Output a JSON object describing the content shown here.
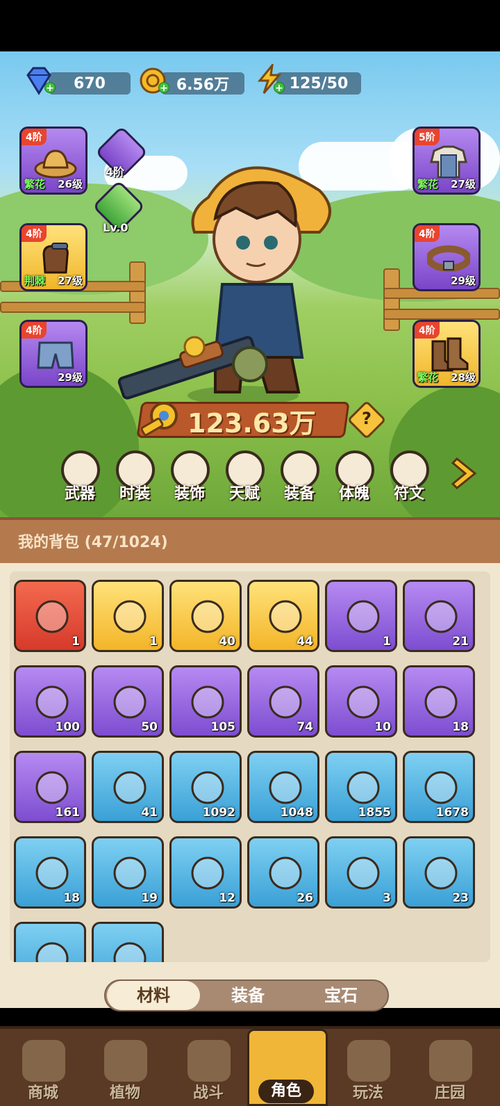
{
  "resources": {
    "gems": "670",
    "gold": "6.56万",
    "energy": "125/50"
  },
  "equipment_left": [
    {
      "tier": "4阶",
      "quality": "繁花",
      "level": "26级",
      "icon": "straw-hat-icon"
    },
    {
      "tier": "4阶",
      "quality": "荆棘",
      "level": "27级",
      "icon": "glove-icon"
    },
    {
      "tier": "4阶",
      "quality": "",
      "level": "29级",
      "icon": "shorts-icon"
    }
  ],
  "equipment_right": [
    {
      "tier": "5阶",
      "quality": "繁花",
      "level": "27级",
      "icon": "overalls-icon"
    },
    {
      "tier": "4阶",
      "quality": "",
      "level": "29级",
      "icon": "belt-icon"
    },
    {
      "tier": "4阶",
      "quality": "繁花",
      "level": "28级",
      "icon": "boots-icon"
    }
  ],
  "mini_slots": [
    {
      "label": "4阶",
      "icon": "bag-icon"
    },
    {
      "label": "Lv.0",
      "icon": "green-gem-icon"
    }
  ],
  "power": "123.63万",
  "categories": [
    "武器",
    "时装",
    "装饰",
    "天赋",
    "装备",
    "体魄",
    "符文"
  ],
  "bag": {
    "title": "我的背包 (47/1024)",
    "items": [
      {
        "count": "1",
        "rarity": "red",
        "icon": "red-potion-icon"
      },
      {
        "count": "1",
        "rarity": "gold",
        "icon": "gold-key-icon"
      },
      {
        "count": "40",
        "rarity": "gold",
        "icon": "orange-potion-icon"
      },
      {
        "count": "44",
        "rarity": "gold",
        "icon": "spell-book-icon"
      },
      {
        "count": "1",
        "rarity": "purple",
        "icon": "silver-key-icon"
      },
      {
        "count": "21",
        "rarity": "purple",
        "icon": "green-scroll-icon"
      },
      {
        "count": "100",
        "rarity": "purple",
        "icon": "scroll-icon"
      },
      {
        "count": "50",
        "rarity": "purple",
        "icon": "water-scroll-icon"
      },
      {
        "count": "105",
        "rarity": "purple",
        "icon": "fire-scroll-icon"
      },
      {
        "count": "74",
        "rarity": "purple",
        "icon": "lightning-scroll-icon"
      },
      {
        "count": "10",
        "rarity": "purple",
        "icon": "purple-potion-icon"
      },
      {
        "count": "18",
        "rarity": "purple",
        "icon": "gold-drop-icon"
      },
      {
        "count": "161",
        "rarity": "purple",
        "icon": "crystal-icon"
      },
      {
        "count": "41",
        "rarity": "blue",
        "icon": "green-orb-icon"
      },
      {
        "count": "1092",
        "rarity": "blue",
        "icon": "purple-orb-icon"
      },
      {
        "count": "1048",
        "rarity": "blue",
        "icon": "water-orb-icon"
      },
      {
        "count": "1855",
        "rarity": "blue",
        "icon": "fire-orb-icon"
      },
      {
        "count": "1678",
        "rarity": "blue",
        "icon": "lightning-orb-icon"
      },
      {
        "count": "18",
        "rarity": "blue",
        "icon": "blue-potion-icon"
      },
      {
        "count": "19",
        "rarity": "blue",
        "icon": "hat-blueprint-icon"
      },
      {
        "count": "12",
        "rarity": "blue",
        "icon": "shirt-blueprint-icon"
      },
      {
        "count": "26",
        "rarity": "blue",
        "icon": "pants-blueprint-icon"
      },
      {
        "count": "3",
        "rarity": "blue",
        "icon": "belt-blueprint-icon"
      },
      {
        "count": "23",
        "rarity": "blue",
        "icon": "shorts-blueprint-icon"
      },
      {
        "count": "",
        "rarity": "blue",
        "icon": "blueprint-icon"
      },
      {
        "count": "",
        "rarity": "blue",
        "icon": "blueprint-icon"
      }
    ]
  },
  "tabs": [
    {
      "label": "材料",
      "active": true
    },
    {
      "label": "装备",
      "active": false
    },
    {
      "label": "宝石",
      "active": false
    }
  ],
  "nav": [
    {
      "label": "商城",
      "icon": "shop-icon"
    },
    {
      "label": "植物",
      "icon": "plant-icon"
    },
    {
      "label": "战斗",
      "icon": "battle-icon"
    },
    {
      "label": "角色",
      "icon": "character-icon",
      "active": true
    },
    {
      "label": "玩法",
      "icon": "gameplay-icon"
    },
    {
      "label": "庄园",
      "icon": "lock-icon"
    }
  ]
}
